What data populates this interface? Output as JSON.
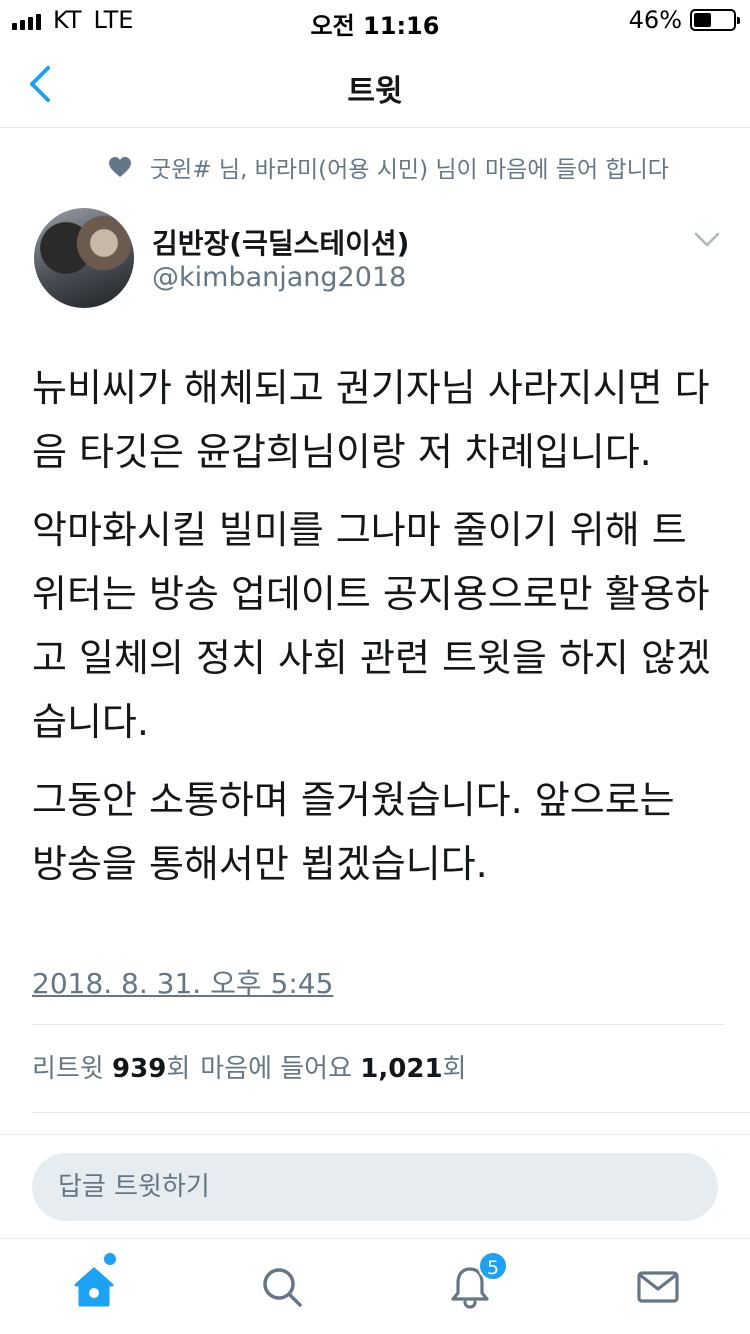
{
  "status_bar": {
    "carrier": "KT",
    "network": "LTE",
    "time": "오전 11:16",
    "battery_percent": "46%",
    "battery_level": 0.46
  },
  "nav": {
    "title": "트윗",
    "back_icon": "chevron-left-icon",
    "accent_color": "#1da1f2"
  },
  "social_context": {
    "icon": "heart-icon",
    "text": "굿윈# 님, 바라미(어용 시민) 님이 마음에 들어 합니다"
  },
  "author": {
    "display_name": "김반장(극딜스테이션)",
    "screen_name": "@kimbanjang2018"
  },
  "tweet": {
    "paragraphs": [
      "뉴비씨가 해체되고 권기자님 사라지시면 다음 타깃은 윤갑희님이랑 저 차례입니다.",
      "악마화시킬 빌미를 그나마 줄이기 위해 트위터는 방송 업데이트 공지용으로만 활용하고 일체의 정치 사회 관련 트윗을 하지 않겠습니다.",
      "그동안 소통하며 즐거웠습니다. 앞으로는 방송을 통해서만 뵙겠습니다."
    ],
    "timestamp": "2018. 8. 31. 오후 5:45"
  },
  "stats": {
    "retweet_label": "리트윗",
    "retweet_count": "939",
    "retweet_unit": "회",
    "like_label": "마음에 들어요",
    "like_count": "1,021",
    "like_unit": "회"
  },
  "reply": {
    "placeholder": "답글 트윗하기"
  },
  "tab_bar": {
    "notification_badge": "5",
    "icons": [
      "home-icon",
      "search-icon",
      "bell-icon",
      "mail-icon"
    ]
  }
}
